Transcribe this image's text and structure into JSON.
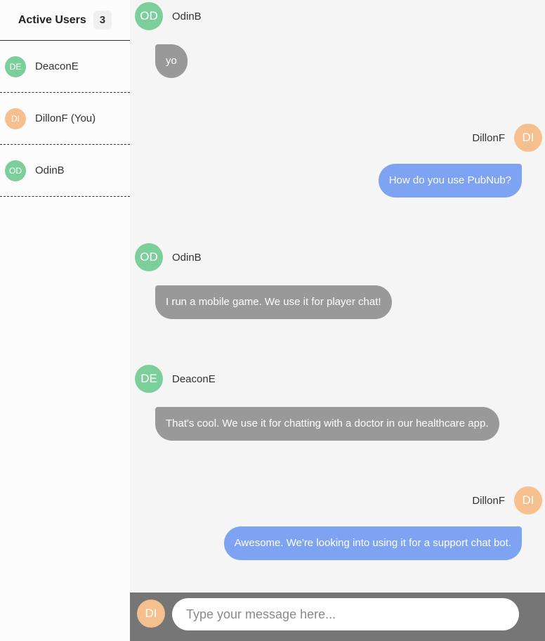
{
  "colors": {
    "avatar_green": "#7ccf9a",
    "avatar_orange": "#f6c08e",
    "bubble_other": "#999999",
    "bubble_mine": "#7ea3f3",
    "composer_bg": "#767676"
  },
  "sidebar": {
    "title": "Active Users",
    "count": "3",
    "users": [
      {
        "initials": "DE",
        "name": "DeaconE",
        "avatar_color": "green"
      },
      {
        "initials": "DI",
        "name": "DillonF (You)",
        "avatar_color": "orange"
      },
      {
        "initials": "OD",
        "name": "OdinB",
        "avatar_color": "green"
      }
    ]
  },
  "messages": [
    {
      "initials": "OD",
      "sender": "OdinB",
      "text": "yo",
      "mine": false
    },
    {
      "initials": "DI",
      "sender": "DillonF",
      "text": "How do you use PubNub?",
      "mine": true
    },
    {
      "initials": "OD",
      "sender": "OdinB",
      "text": "I run a mobile game. We use it for player chat!",
      "mine": false
    },
    {
      "initials": "DE",
      "sender": "DeaconE",
      "text": "That's cool. We use it for chatting with a doctor in our healthcare app.",
      "mine": false
    },
    {
      "initials": "DI",
      "sender": "DillonF",
      "text": "Awesome. We're looking into using it for a support chat bot.",
      "mine": true
    }
  ],
  "composer": {
    "initials": "DI",
    "placeholder": "Type your message here..."
  }
}
